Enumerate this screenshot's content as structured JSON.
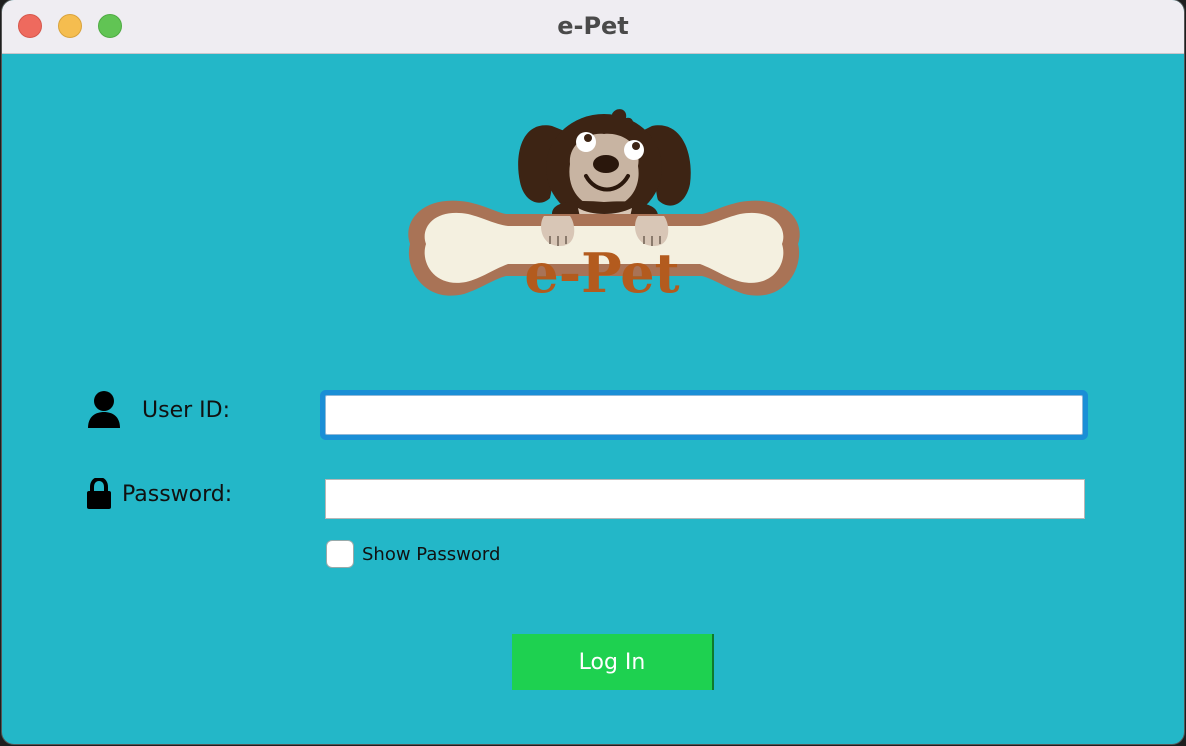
{
  "window": {
    "title": "e-Pet"
  },
  "logo": {
    "text": "e-Pet",
    "icon": "dog-on-bone-logo"
  },
  "form": {
    "user_id_label": "User ID:",
    "user_id_value": "",
    "password_label": "Password:",
    "password_value": "",
    "show_password_label": "Show Password",
    "show_password_checked": false,
    "login_label": "Log In"
  },
  "icons": {
    "user": "user-icon",
    "password": "lock-icon"
  },
  "colors": {
    "background": "#23b7c8",
    "login_button": "#1ed150",
    "focus_ring": "#1a8fd6",
    "logo_text": "#b35b1e"
  }
}
